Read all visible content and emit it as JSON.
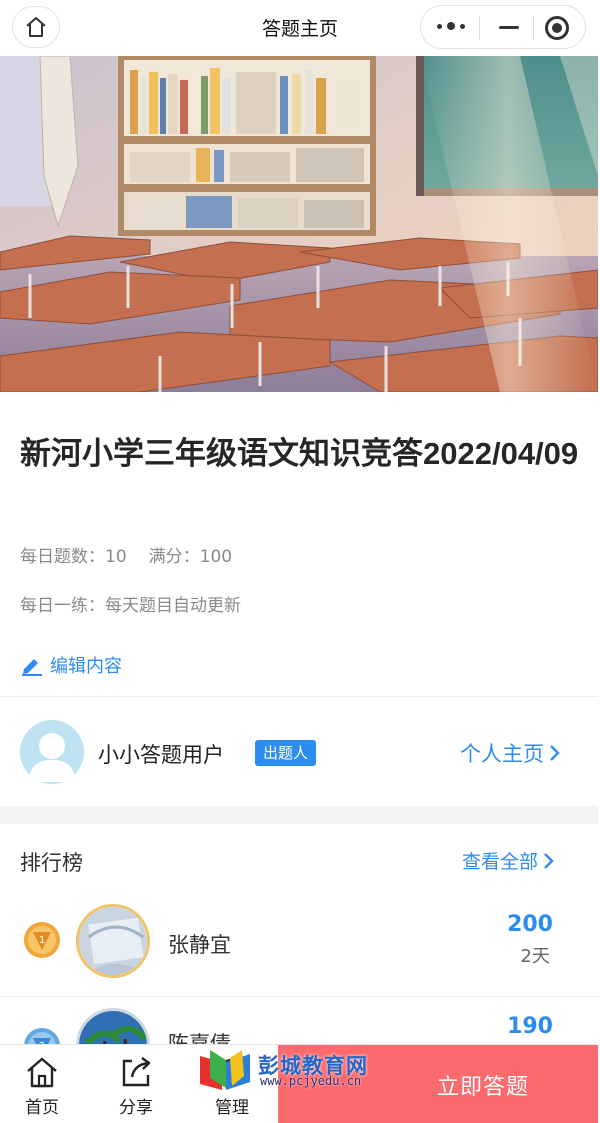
{
  "navbar": {
    "title": "答题主页",
    "home_icon": "home-icon",
    "more_icon": "more-dots-icon",
    "minimize_icon": "minimize-icon",
    "close_icon": "target-close-icon"
  },
  "quiz": {
    "title": "新河小学三年级语文知识竞答2022/04/09",
    "daily_count_label": "每日题数：",
    "daily_count": "10",
    "full_score_label": "满分：",
    "full_score": "100",
    "practice_note": "每日一练：每天题目自动更新",
    "edit_label": "编辑内容"
  },
  "author": {
    "name": "小小答题用户",
    "role_badge": "出题人",
    "profile_link": "个人主页"
  },
  "ranking": {
    "title": "排行榜",
    "view_all": "查看全部",
    "entries": [
      {
        "rank": "1",
        "name": "张静宜",
        "score": "200",
        "time": "2天"
      },
      {
        "rank": "2",
        "name": "陈嘉倩",
        "score": "190",
        "time": ""
      }
    ]
  },
  "tabbar": {
    "home": "首页",
    "share": "分享",
    "manage": "管理",
    "start": "立即答题"
  },
  "watermark": {
    "title": "彭城教育网",
    "url": "www.pcjyedu.cn"
  },
  "colors": {
    "accent": "#2d8cf0",
    "start_button": "#fb6b6e",
    "muted_text": "#8a8a8a"
  }
}
